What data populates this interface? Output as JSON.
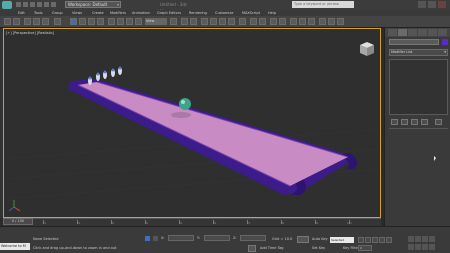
{
  "window": {
    "workspace": "Workspace: Default",
    "title": "Untitled - 3ds Max",
    "search_placeholder": "Type a keyword or phrase"
  },
  "menu": {
    "items": [
      "Edit",
      "Tools",
      "Group",
      "Views",
      "Create",
      "Modifiers",
      "Animation",
      "Graph Editors",
      "Rendering",
      "Customize",
      "MAXScript",
      "Help"
    ]
  },
  "toolbar": {
    "view_dropdown": "View"
  },
  "viewport": {
    "label": "[+] [Perspective] [Realistic]"
  },
  "command_panel": {
    "modifier_list": "Modifier List",
    "object_color": "#5a2cc7"
  },
  "timeline": {
    "slider": "0 / 100",
    "frames": [
      "0",
      "10",
      "20",
      "30",
      "40",
      "50",
      "60",
      "70",
      "80",
      "90",
      "100"
    ]
  },
  "status": {
    "maxscript": "Welcome to M",
    "selection": "None Selected",
    "prompt": "Click and drag up-and-down to zoom in and out",
    "x_label": "X:",
    "y_label": "Y:",
    "z_label": "Z:",
    "grid": "Grid = 10.0",
    "add_time_tag": "Add Time Tag",
    "auto_key": "Auto Key",
    "set_key": "Set Key",
    "key_filter_value": "Selected",
    "key_filters": "Key Filters...",
    "frame_field": "0"
  }
}
